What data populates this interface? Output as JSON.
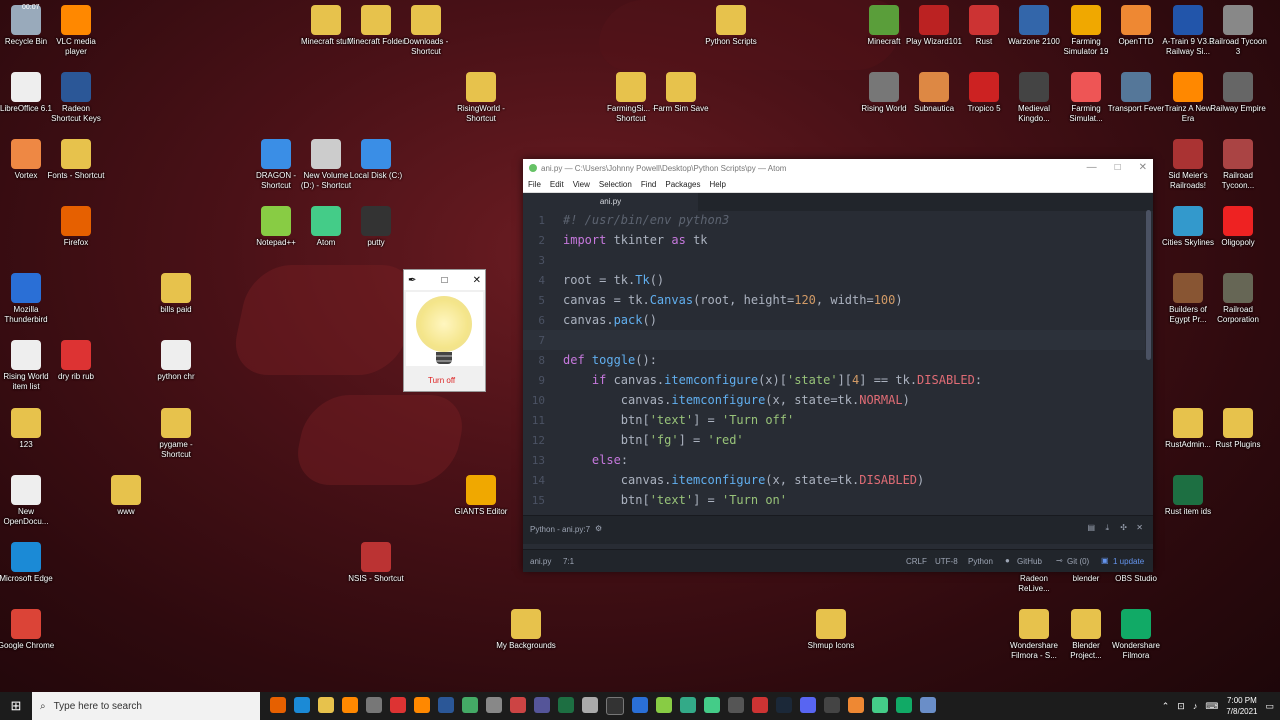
{
  "desktop": {
    "icons": [
      {
        "label": "Recycle Bin",
        "color": "#9ab"
      },
      {
        "label": "VLC media player",
        "color": "#f80"
      },
      {
        "label": "LibreOffice 6.1",
        "color": "#eee"
      },
      {
        "label": "Radeon Shortcut Keys",
        "color": "#2b5797"
      },
      {
        "label": "Vortex",
        "color": "#e84"
      },
      {
        "label": "Fonts - Shortcut",
        "color": "#e7c24c"
      },
      {
        "label": "Firefox",
        "color": "#e66000"
      },
      {
        "label": "Mozilla Thunderbird",
        "color": "#2a6fd6"
      },
      {
        "label": "Rising World item list",
        "color": "#eee"
      },
      {
        "label": "dry rib rub",
        "color": "#d33"
      },
      {
        "label": "123",
        "color": "#e7c24c"
      },
      {
        "label": "New OpenDocu...",
        "color": "#eee"
      },
      {
        "label": "www",
        "color": "#e7c24c"
      },
      {
        "label": "Microsoft Edge",
        "color": "#1b8ad6"
      },
      {
        "label": "Google Chrome",
        "color": "#db4437"
      },
      {
        "label": "Minecraft stuff",
        "color": "#e7c24c"
      },
      {
        "label": "Minecraft Folder",
        "color": "#e7c24c"
      },
      {
        "label": "Downloads - Shortcut",
        "color": "#e7c24c"
      },
      {
        "label": "RisingWorld - Shortcut",
        "color": "#e7c24c"
      },
      {
        "label": "DRAGON - Shortcut",
        "color": "#3a8ee6"
      },
      {
        "label": "New Volume (D:) - Shortcut",
        "color": "#ccc"
      },
      {
        "label": "Local Disk (C:)",
        "color": "#3a8ee6"
      },
      {
        "label": "Notepad++",
        "color": "#8c4"
      },
      {
        "label": "Atom",
        "color": "#4c8"
      },
      {
        "label": "putty",
        "color": "#333"
      },
      {
        "label": "bills paid",
        "color": "#e7c24c"
      },
      {
        "label": "python chr",
        "color": "#eee"
      },
      {
        "label": "pygame - Shortcut",
        "color": "#e7c24c"
      },
      {
        "label": "NSIS - Shortcut",
        "color": "#b33"
      },
      {
        "label": "My Backgrounds",
        "color": "#e7c24c"
      },
      {
        "label": "GIANTS Editor",
        "color": "#f0a800"
      },
      {
        "label": "Python Scripts",
        "color": "#e7c24c"
      },
      {
        "label": "FarmingSi... - Shortcut",
        "color": "#e7c24c"
      },
      {
        "label": "Farm Sim Save",
        "color": "#e7c24c"
      },
      {
        "label": "Shmup Icons",
        "color": "#e7c24c"
      },
      {
        "label": "Minecraft",
        "color": "#5a9e3a"
      },
      {
        "label": "Play Wizard101",
        "color": "#b22"
      },
      {
        "label": "Rust",
        "color": "#c33"
      },
      {
        "label": "Warzone 2100",
        "color": "#3366aa"
      },
      {
        "label": "Farming Simulator 19",
        "color": "#f0a800"
      },
      {
        "label": "OpenTTD",
        "color": "#e83"
      },
      {
        "label": "A-Train 9 V3.0 Railway Si...",
        "color": "#2255aa"
      },
      {
        "label": "Railroad Tycoon 3",
        "color": "#888"
      },
      {
        "label": "Rising World",
        "color": "#777"
      },
      {
        "label": "Subnautica",
        "color": "#d84"
      },
      {
        "label": "Tropico 5",
        "color": "#c22"
      },
      {
        "label": "Medieval Kingdo...",
        "color": "#444"
      },
      {
        "label": "Farming Simulat...",
        "color": "#e55"
      },
      {
        "label": "Transport Fever",
        "color": "#579"
      },
      {
        "label": "Trainz A New Era",
        "color": "#f80"
      },
      {
        "label": "Railway Empire",
        "color": "#666"
      },
      {
        "label": "Sid Meier's Railroads!",
        "color": "#a33"
      },
      {
        "label": "Railroad Tycoon...",
        "color": "#a44"
      },
      {
        "label": "Cities Skylines",
        "color": "#39c"
      },
      {
        "label": "Oligopoly",
        "color": "#e22"
      },
      {
        "label": "Builders of Egypt Pr...",
        "color": "#853"
      },
      {
        "label": "Railroad Corporation",
        "color": "#665"
      },
      {
        "label": "RustAdmin...",
        "color": "#e7c24c"
      },
      {
        "label": "Rust Plugins",
        "color": "#e7c24c"
      },
      {
        "label": "Rust item ids",
        "color": "#1d6f42"
      },
      {
        "label": "Radeon ReLive...",
        "color": "#e7c24c"
      },
      {
        "label": "blender",
        "color": "#e7c24c"
      },
      {
        "label": "OBS Studio",
        "color": "#e7c24c"
      },
      {
        "label": "Wondershare Filmora - S...",
        "color": "#e7c24c"
      },
      {
        "label": "Blender Project...",
        "color": "#e7c24c"
      },
      {
        "label": "Wondershare Filmora",
        "color": "#1a6"
      }
    ],
    "top_clock": "00:07"
  },
  "tk_window": {
    "button_text": "Turn off"
  },
  "atom": {
    "title": "ani.py — C:\\Users\\Johnny Powell\\Desktop\\Python Scripts\\py — Atom",
    "menu": [
      "File",
      "Edit",
      "View",
      "Selection",
      "Find",
      "Packages",
      "Help"
    ],
    "tab": "ani.py",
    "panel_label": "Python - ani.py:7",
    "status": {
      "file": "ani.py",
      "cursor": "7:1",
      "line_ending": "CRLF",
      "encoding": "UTF-8",
      "grammar": "Python",
      "github": "GitHub",
      "git": "Git (0)",
      "update": "1 update"
    },
    "code_lines": [
      "1",
      "2",
      "3",
      "4",
      "5",
      "6",
      "7",
      "8",
      "9",
      "10",
      "11",
      "12",
      "13",
      "14",
      "15"
    ]
  },
  "taskbar": {
    "search_placeholder": "Type here to search",
    "time": "7:00 PM",
    "date": "7/8/2021"
  }
}
